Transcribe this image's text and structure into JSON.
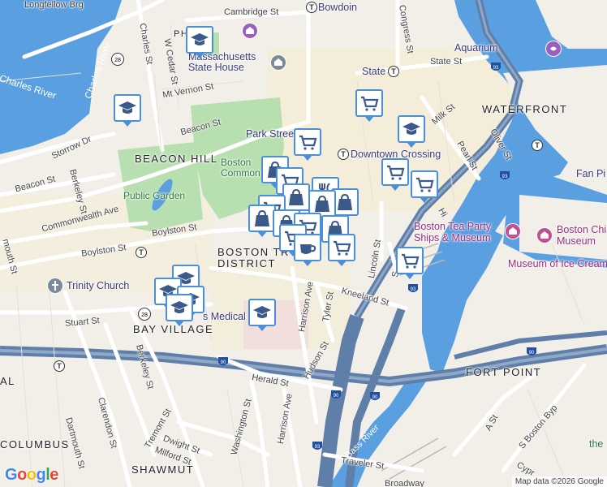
{
  "colors": {
    "land": "#f2efe9",
    "water": "#5a9fe0",
    "park": "#b7dfb0",
    "highway": "#5f7fa8",
    "road": "#ffffff",
    "marker_border": "#4a8fd9",
    "marker_icon": "#3b5a8a"
  },
  "districts": {
    "beacon_hill": "BEACON HILL",
    "waterfront": "WATERFRONT",
    "boston_district": "BOSTON TR DISTRICT",
    "bay_village": "BAY VILLAGE",
    "fort_point": "FORT POINT",
    "columbus": "COLUMBUS",
    "shawmut": "SHAWMUT",
    "ph": "PH",
    "al": "AL"
  },
  "water": {
    "charles": "Charles River",
    "charles2": "Charles River",
    "bass": "Bass River"
  },
  "parks": {
    "common": "Boston\nCommon",
    "garden": "Public Garden"
  },
  "pois": {
    "bowdoin": "Bowdoin",
    "state": "State",
    "aquarium": "Aquarium",
    "park_street": "Park Street",
    "downtown": "Downtown Crossing",
    "statehouse": "Massachusetts\nState House",
    "tea_party": "Boston Tea Party\nShips & Museum",
    "children": "Boston Children's\nMuseum",
    "ice_cream": "Museum of Ice Cream",
    "trinity": "Trinity Church",
    "fan_pier": "Fan Pi",
    "medical": "s Medical",
    "the": "the"
  },
  "streets": {
    "longfellow": "Longfellow Brg",
    "cambridge": "Cambridge St",
    "congress": "Congress St",
    "charles_st": "Charles St",
    "w_cedar": "W Cedar St",
    "mt_vernon": "Mt Vernon St",
    "beacon": "Beacon St",
    "beacon2": "Beacon St",
    "storrow": "Storrow Dr",
    "state_st": "State St",
    "milk": "Milk St",
    "oliver": "Oliver St",
    "pearl": "Pearl St",
    "berkeley": "Berkeley St",
    "berkeley2": "Berkeley St",
    "commonwealth": "Commonwealth Ave",
    "boylston": "Boylston St",
    "boylston2": "Boylston St",
    "mouth": "mouth St",
    "stuart": "Stuart St",
    "kneeland": "Kneeland St",
    "harrison": "Harrison Ave",
    "harrison2": "Harrison Ave",
    "tyler": "Tyler St",
    "hudson": "Hudson St",
    "lincoln": "Lincoln St",
    "herald": "Herald St",
    "washington": "Washington St",
    "clarendon": "Clarendon St",
    "dartmouth": "Dartmouth St",
    "tremont": "Tremont St",
    "dwight": "Dwight St",
    "milford": "Milford St",
    "traveler": "Traveler St",
    "a_st": "A St",
    "s_boston": "S Boston Byp",
    "hi": "Hi",
    "s_st": "S",
    "broadway": "Broadway",
    "cypr": "Cypr"
  },
  "highway_shields": [
    "28",
    "28",
    "93",
    "93",
    "93",
    "90",
    "90",
    "90",
    "93",
    "93"
  ],
  "map_markers": [
    {
      "type": "school"
    },
    {
      "type": "school"
    },
    {
      "type": "shop"
    },
    {
      "type": "school"
    },
    {
      "type": "shop"
    },
    {
      "type": "shop"
    },
    {
      "type": "shop"
    },
    {
      "type": "shop"
    },
    {
      "type": "shop"
    },
    {
      "type": "school"
    },
    {
      "type": "school"
    },
    {
      "type": "school"
    },
    {
      "type": "school"
    },
    {
      "type": "shop"
    },
    {
      "type": "cafe"
    },
    {
      "type": "shop"
    }
  ],
  "attribution": "Map data ©2026 Google",
  "google_logo": "Google"
}
